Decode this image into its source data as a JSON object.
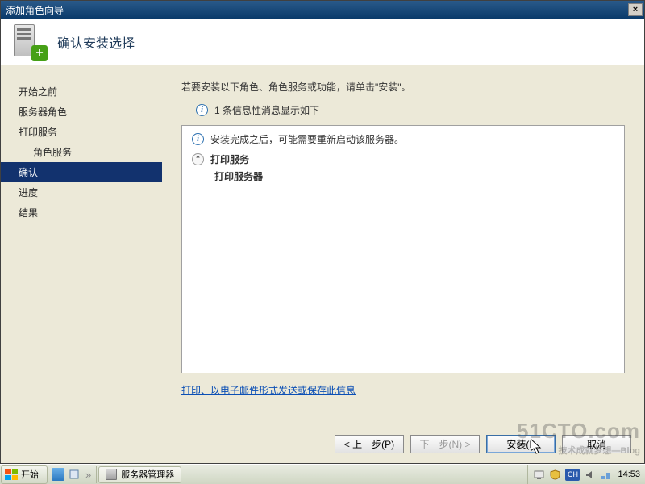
{
  "window": {
    "title": "添加角色向导",
    "close_icon": "×"
  },
  "header": {
    "heading": "确认安装选择",
    "plus": "+"
  },
  "sidebar": {
    "items": [
      {
        "label": "开始之前",
        "child": false
      },
      {
        "label": "服务器角色",
        "child": false
      },
      {
        "label": "打印服务",
        "child": false
      },
      {
        "label": "角色服务",
        "child": true
      },
      {
        "label": "确认",
        "child": false,
        "active": true
      },
      {
        "label": "进度",
        "child": false
      },
      {
        "label": "结果",
        "child": false
      }
    ]
  },
  "main": {
    "intro": "若要安装以下角色、角色服务或功能，请单击\"安装\"。",
    "info_line": "1 条信息性消息显示如下",
    "box": {
      "message": "安装完成之后，可能需要重新启动该服务器。",
      "service_title": "打印服务",
      "service_detail": "打印服务器",
      "chevron": "⌃"
    },
    "link": "打印、以电子邮件形式发送或保存此信息"
  },
  "footer": {
    "prev": "< 上一步(P)",
    "next": "下一步(N) >",
    "install": "安装(I)",
    "cancel": "取消"
  },
  "watermark": {
    "main": "51CTO.com",
    "sub": "技术成就梦想—Blog"
  },
  "taskbar": {
    "start": "开始",
    "task1": "服务器管理器",
    "lang": "CH",
    "clock": "14:53",
    "sep": "»"
  }
}
